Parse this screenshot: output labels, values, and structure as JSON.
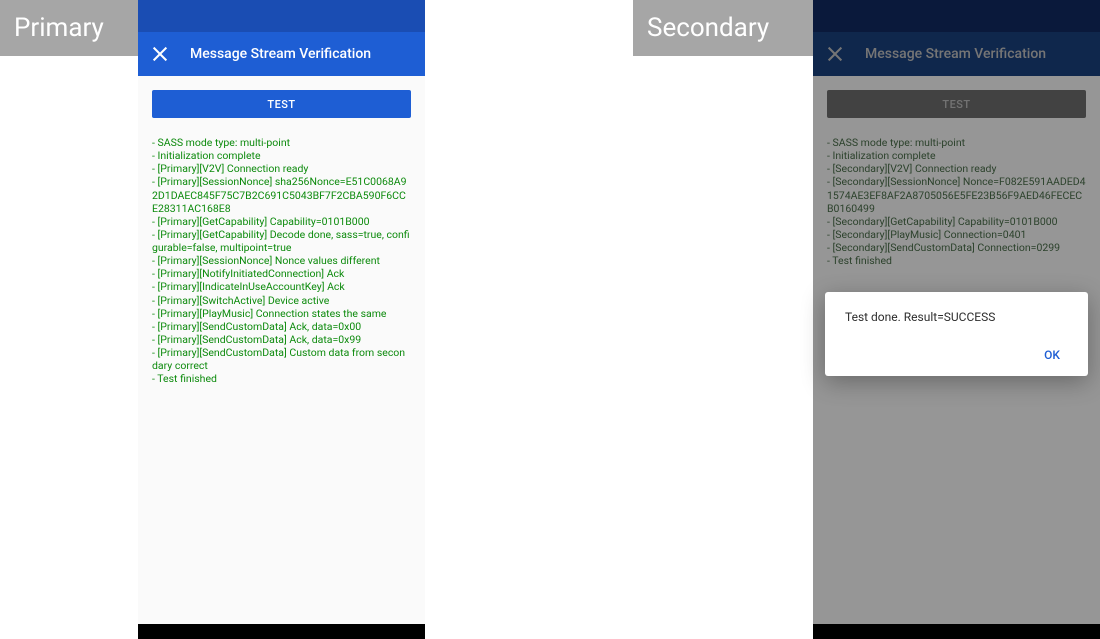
{
  "roles": {
    "primary_label": "Primary",
    "secondary_label": "Secondary"
  },
  "appbar": {
    "title": "Message Stream Verification"
  },
  "test_button_label": "TEST",
  "primary_log": [
    " - SASS mode type: multi-point",
    " - Initialization complete",
    " - [Primary][V2V] Connection ready",
    " - [Primary][SessionNonce] sha256Nonce=E51C0068A92D1DAEC845F75C7B2C691C5043BF7F2CBA590F6CCE28311AC168E8",
    " - [Primary][GetCapability] Capability=0101B000",
    " - [Primary][GetCapability] Decode done, sass=true, configurable=false, multipoint=true",
    " - [Primary][SessionNonce] Nonce values different",
    " - [Primary][NotifyInitiatedConnection] Ack",
    " - [Primary][IndicateInUseAccountKey] Ack",
    " - [Primary][SwitchActive] Device active",
    " - [Primary][PlayMusic] Connection states the same",
    " - [Primary][SendCustomData] Ack, data=0x00",
    " - [Primary][SendCustomData] Ack, data=0x99",
    " - [Primary][SendCustomData] Custom data from secondary correct",
    " - Test finished"
  ],
  "secondary_log": [
    " - SASS mode type: multi-point",
    " - Initialization complete",
    " - [Secondary][V2V] Connection ready",
    " - [Secondary][SessionNonce] Nonce=F082E591AADED41574AE3EF8AF2A8705056E5FE23B56F9AED46FECECB0160499",
    " - [Secondary][GetCapability] Capability=0101B000",
    " - [Secondary][PlayMusic] Connection=0401",
    " - [Secondary][SendCustomData] Connection=0299",
    " - Test finished"
  ],
  "dialog": {
    "message": "Test done. Result=SUCCESS",
    "ok": "OK"
  }
}
